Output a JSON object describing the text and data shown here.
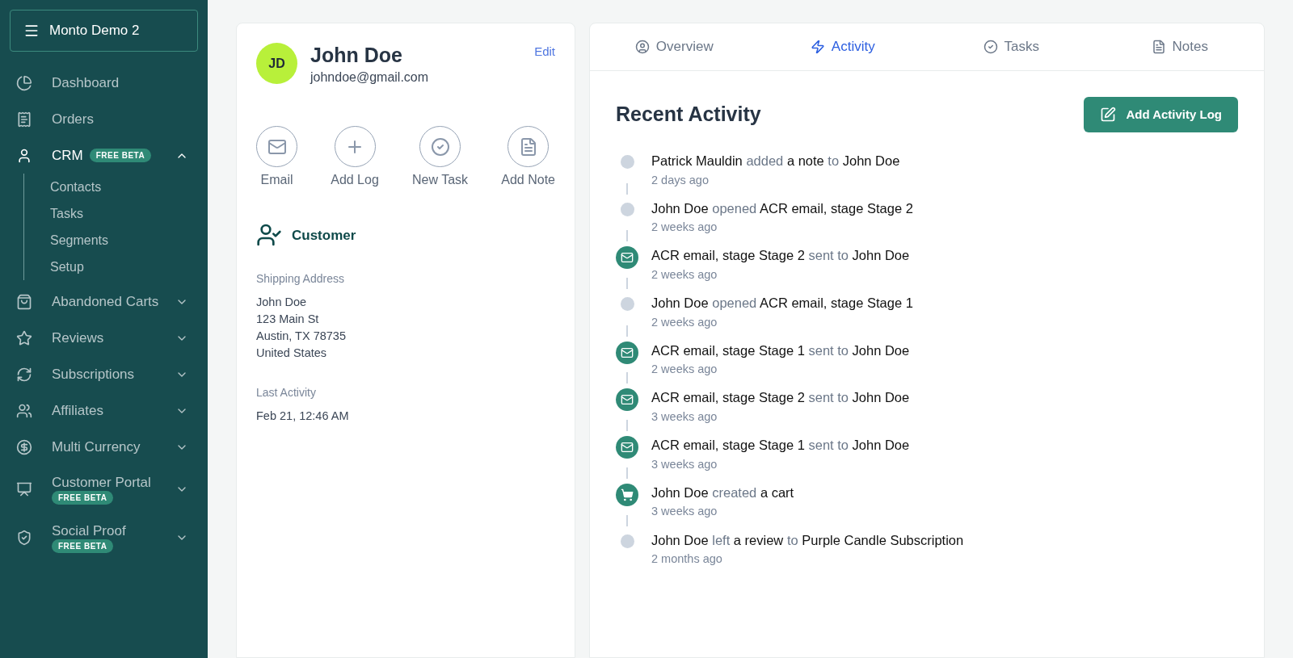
{
  "sidebar": {
    "store": "Monto Demo 2",
    "items": [
      {
        "label": "Dashboard",
        "active": false
      },
      {
        "label": "Orders",
        "active": false
      },
      {
        "label": "CRM",
        "active": true,
        "badge": "FREE BETA",
        "expanded": true,
        "children": [
          {
            "label": "Contacts"
          },
          {
            "label": "Tasks"
          },
          {
            "label": "Segments"
          },
          {
            "label": "Setup"
          }
        ]
      },
      {
        "label": "Abandoned Carts",
        "active": false,
        "expanded": false
      },
      {
        "label": "Reviews",
        "active": false,
        "expanded": false
      },
      {
        "label": "Subscriptions",
        "active": false,
        "expanded": false
      },
      {
        "label": "Affiliates",
        "active": false,
        "expanded": false
      },
      {
        "label": "Multi Currency",
        "active": false,
        "expanded": false
      },
      {
        "label": "Customer Portal",
        "active": false,
        "badge": "FREE BETA",
        "expanded": false
      },
      {
        "label": "Social Proof",
        "active": false,
        "badge": "FREE BETA",
        "expanded": false
      }
    ]
  },
  "contact": {
    "initials": "JD",
    "name": "John Doe",
    "email": "johndoe@gmail.com",
    "edit": "Edit",
    "actions": [
      {
        "label": "Email"
      },
      {
        "label": "Add Log"
      },
      {
        "label": "New Task"
      },
      {
        "label": "Add Note"
      }
    ],
    "segment": "Customer",
    "fields": [
      {
        "label": "Shipping Address",
        "lines": [
          "John Doe",
          "123 Main St",
          "Austin, TX 78735",
          "United States"
        ]
      },
      {
        "label": "Last Activity",
        "lines": [
          "Feb 21, 12:46 AM"
        ]
      }
    ]
  },
  "tabs": [
    {
      "label": "Overview",
      "selected": false
    },
    {
      "label": "Activity",
      "selected": true
    },
    {
      "label": "Tasks",
      "selected": false
    },
    {
      "label": "Notes",
      "selected": false
    }
  ],
  "activity": {
    "title": "Recent Activity",
    "button": "Add Activity Log",
    "events": [
      {
        "kind": "dot",
        "time": "2 days ago",
        "parts": [
          {
            "text": "Patrick Mauldin",
            "strong": true
          },
          {
            "text": "added",
            "strong": false
          },
          {
            "text": "a note",
            "strong": true
          },
          {
            "text": "to",
            "strong": false
          },
          {
            "text": "John Doe",
            "strong": true
          }
        ]
      },
      {
        "kind": "dot",
        "time": "2 weeks ago",
        "parts": [
          {
            "text": "John Doe",
            "strong": true
          },
          {
            "text": "opened",
            "strong": false
          },
          {
            "text": "ACR email, stage Stage 2",
            "strong": true
          }
        ]
      },
      {
        "kind": "email",
        "time": "2 weeks ago",
        "parts": [
          {
            "text": "ACR email, stage Stage 2",
            "strong": true
          },
          {
            "text": "sent to",
            "strong": false
          },
          {
            "text": "John Doe",
            "strong": true
          }
        ]
      },
      {
        "kind": "dot",
        "time": "2 weeks ago",
        "parts": [
          {
            "text": "John Doe",
            "strong": true
          },
          {
            "text": "opened",
            "strong": false
          },
          {
            "text": "ACR email, stage Stage 1",
            "strong": true
          }
        ]
      },
      {
        "kind": "email",
        "time": "2 weeks ago",
        "parts": [
          {
            "text": "ACR email, stage Stage 1",
            "strong": true
          },
          {
            "text": "sent to",
            "strong": false
          },
          {
            "text": "John Doe",
            "strong": true
          }
        ]
      },
      {
        "kind": "email",
        "time": "3 weeks ago",
        "parts": [
          {
            "text": "ACR email, stage Stage 2",
            "strong": true
          },
          {
            "text": "sent to",
            "strong": false
          },
          {
            "text": "John Doe",
            "strong": true
          }
        ]
      },
      {
        "kind": "email",
        "time": "3 weeks ago",
        "parts": [
          {
            "text": "ACR email, stage Stage 1",
            "strong": true
          },
          {
            "text": "sent to",
            "strong": false
          },
          {
            "text": "John Doe",
            "strong": true
          }
        ]
      },
      {
        "kind": "cart",
        "time": "3 weeks ago",
        "parts": [
          {
            "text": "John Doe",
            "strong": true
          },
          {
            "text": "created",
            "strong": false
          },
          {
            "text": "a cart",
            "strong": true
          }
        ]
      },
      {
        "kind": "dot",
        "time": "2 months ago",
        "parts": [
          {
            "text": "John Doe",
            "strong": true
          },
          {
            "text": "left",
            "strong": false
          },
          {
            "text": "a review",
            "strong": true
          },
          {
            "text": "to",
            "strong": false
          },
          {
            "text": "Purple Candle Subscription",
            "strong": true
          }
        ]
      }
    ]
  }
}
